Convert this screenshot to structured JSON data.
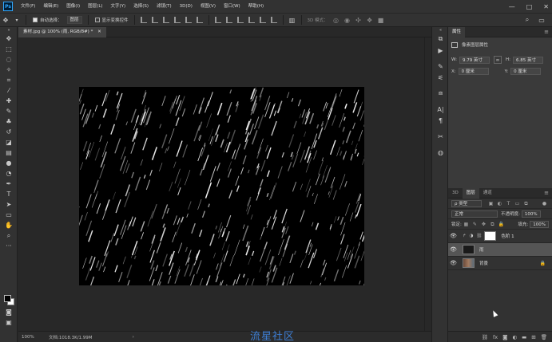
{
  "app": {
    "logo": "Ps"
  },
  "menu": [
    "文件(F)",
    "编辑(E)",
    "图像(I)",
    "图层(L)",
    "文字(Y)",
    "选择(S)",
    "滤镜(T)",
    "3D(D)",
    "视图(V)",
    "窗口(W)",
    "帮助(H)"
  ],
  "window_controls": {
    "minimize": "—",
    "maximize": "□",
    "close": "✕"
  },
  "options": {
    "auto_select_label": "自动选择：",
    "auto_select_value": "图层",
    "show_transform_label": "显示变换控件",
    "mode_3d_label": "3D 模式："
  },
  "document": {
    "tab_title": "素材.jpg @ 100% (雨, RGB/8#) *",
    "close": "✕"
  },
  "status": {
    "zoom": "100%",
    "doc_info": "文档:1018.3K/1.99M",
    "arrow": "›"
  },
  "watermark": "流星社区",
  "properties": {
    "tab": "属性",
    "title": "像素图层属性",
    "w_label": "W:",
    "w_value": "9.79 英寸",
    "h_label": "H:",
    "h_value": "6.85 英寸",
    "x_label": "X:",
    "x_value": "0 厘米",
    "y_label": "Y:",
    "y_value": "0 厘米"
  },
  "layers_panel": {
    "tabs": [
      "3D",
      "图层",
      "通道"
    ],
    "active_tab": "图层",
    "filter": "ρ 类型",
    "blend_mode": "正常",
    "opacity_label": "不透明度:",
    "opacity_value": "100%",
    "lock_label": "锁定:",
    "fill_label": "填充:",
    "fill_value": "100%",
    "layers": [
      {
        "name": "色阶 1",
        "type": "adjustment",
        "selected": false
      },
      {
        "name": "雨",
        "type": "pixel",
        "selected": true
      },
      {
        "name": "背景",
        "type": "background",
        "selected": false
      }
    ]
  },
  "colors": {
    "accent": "#31a8ff",
    "panel_bg": "#323232",
    "canvas_bg": "#282828",
    "watermark": "#3d7fd6"
  }
}
